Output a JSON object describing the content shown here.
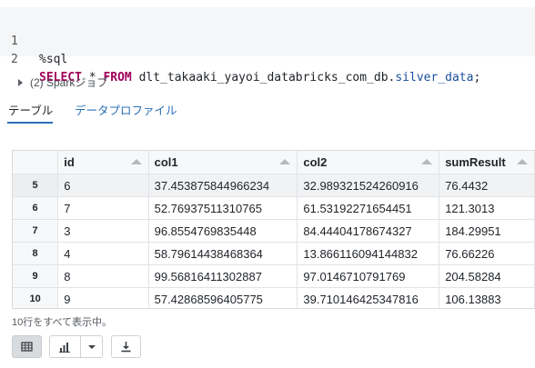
{
  "editor": {
    "lines": [
      {
        "number": "1",
        "text": "%sql"
      },
      {
        "number": "2",
        "keyword_select": "SELECT",
        "star": " * ",
        "keyword_from": "FROM",
        "table_prefix": " dlt_takaaki_yayoi_databricks_com_db.",
        "table_name": "silver_data",
        "terminator": ";"
      }
    ]
  },
  "spark_jobs": {
    "label": "(2) Sparkジョブ"
  },
  "tabs": [
    {
      "label": "テーブル",
      "active": true
    },
    {
      "label": "データプロファイル",
      "active": false
    }
  ],
  "table": {
    "columns": [
      "id",
      "col1",
      "col2",
      "sumResult"
    ],
    "rows": [
      {
        "index": "5",
        "cells": [
          "6",
          "37.453875844966234",
          "32.989321524260916",
          "76.4432"
        ]
      },
      {
        "index": "6",
        "cells": [
          "7",
          "52.76937511310765",
          "61.53192271654451",
          "121.3013"
        ]
      },
      {
        "index": "7",
        "cells": [
          "3",
          "96.8554769835448",
          "84.44404178674327",
          "184.29951"
        ]
      },
      {
        "index": "8",
        "cells": [
          "4",
          "58.79614438468364",
          "13.866116094144832",
          "76.66226"
        ]
      },
      {
        "index": "9",
        "cells": [
          "8",
          "99.56816411302887",
          "97.0146710791769",
          "204.58284"
        ]
      },
      {
        "index": "10",
        "cells": [
          "9",
          "57.42868596405775",
          "39.710146425347816",
          "106.13883"
        ]
      }
    ]
  },
  "footer": {
    "row_count_text": "10行をすべて表示中。",
    "icons": [
      "table-view-icon",
      "bar-chart-icon",
      "chevron-down-icon",
      "download-icon"
    ]
  },
  "colors": {
    "accent": "#2a6fb5",
    "keyword": "#a0005a"
  }
}
